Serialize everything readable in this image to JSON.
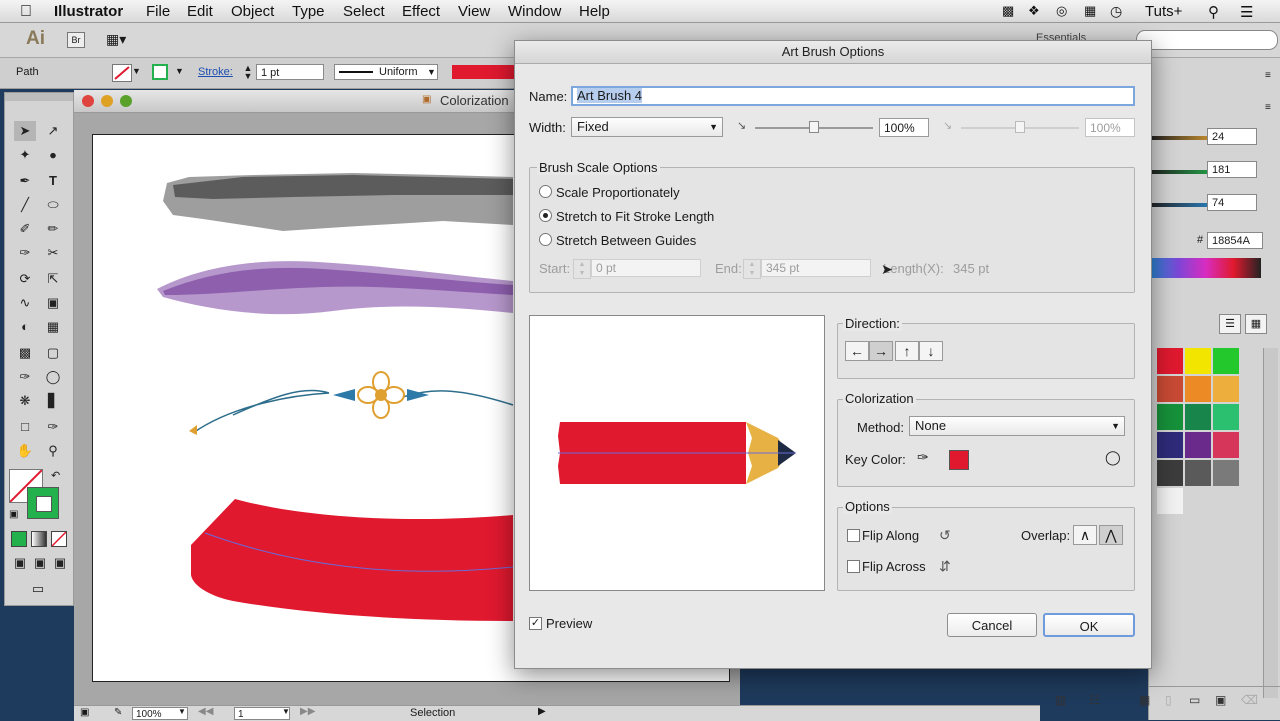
{
  "menubar": {
    "app": "Illustrator",
    "items": [
      "File",
      "Edit",
      "Object",
      "Type",
      "Select",
      "Effect",
      "View",
      "Window",
      "Help"
    ],
    "right_label": "Tuts+"
  },
  "appbar": {
    "logo": "Ai",
    "bridge": "Br",
    "workspace": "Essentials"
  },
  "control_bar": {
    "selection_type": "Path",
    "stroke_label": "Stroke:",
    "stroke_weight": "1 pt",
    "profile": "Uniform"
  },
  "document": {
    "tab_title": "Colorization",
    "zoom": "100%",
    "artboard_num": "1",
    "status_text": "Selection"
  },
  "color_panel": {
    "values": [
      "24",
      "181",
      "74"
    ],
    "hex_prefix": "#",
    "hex": "18854A"
  },
  "dialog": {
    "title": "Art Brush Options",
    "name_label": "Name:",
    "name_value": "Art Brush 4",
    "width_label": "Width:",
    "width_value": "Fixed",
    "width_percent": "100%",
    "width_percent2": "100%",
    "scale_group_label": "Brush Scale Options",
    "scale_options": [
      "Scale Proportionately",
      "Stretch to Fit Stroke Length",
      "Stretch Between Guides"
    ],
    "scale_selected": 1,
    "start_label": "Start:",
    "start_value": "0 pt",
    "end_label": "End:",
    "end_value": "345 pt",
    "length_label": "Length(X):",
    "length_value": "345 pt",
    "direction_label": "Direction:",
    "colorization_label": "Colorization",
    "method_label": "Method:",
    "method_value": "None",
    "key_color_label": "Key Color:",
    "key_color": "#e0192f",
    "options_label": "Options",
    "flip_along": "Flip Along",
    "flip_across": "Flip Across",
    "overlap_label": "Overlap:",
    "preview_label": "Preview",
    "cancel_label": "Cancel",
    "ok_label": "OK"
  },
  "colors": {
    "pencil_red": "#e0192f",
    "pencil_wood": "#e7b144",
    "pencil_tip": "#1f2a44",
    "stroke_green": "#23b14d"
  }
}
